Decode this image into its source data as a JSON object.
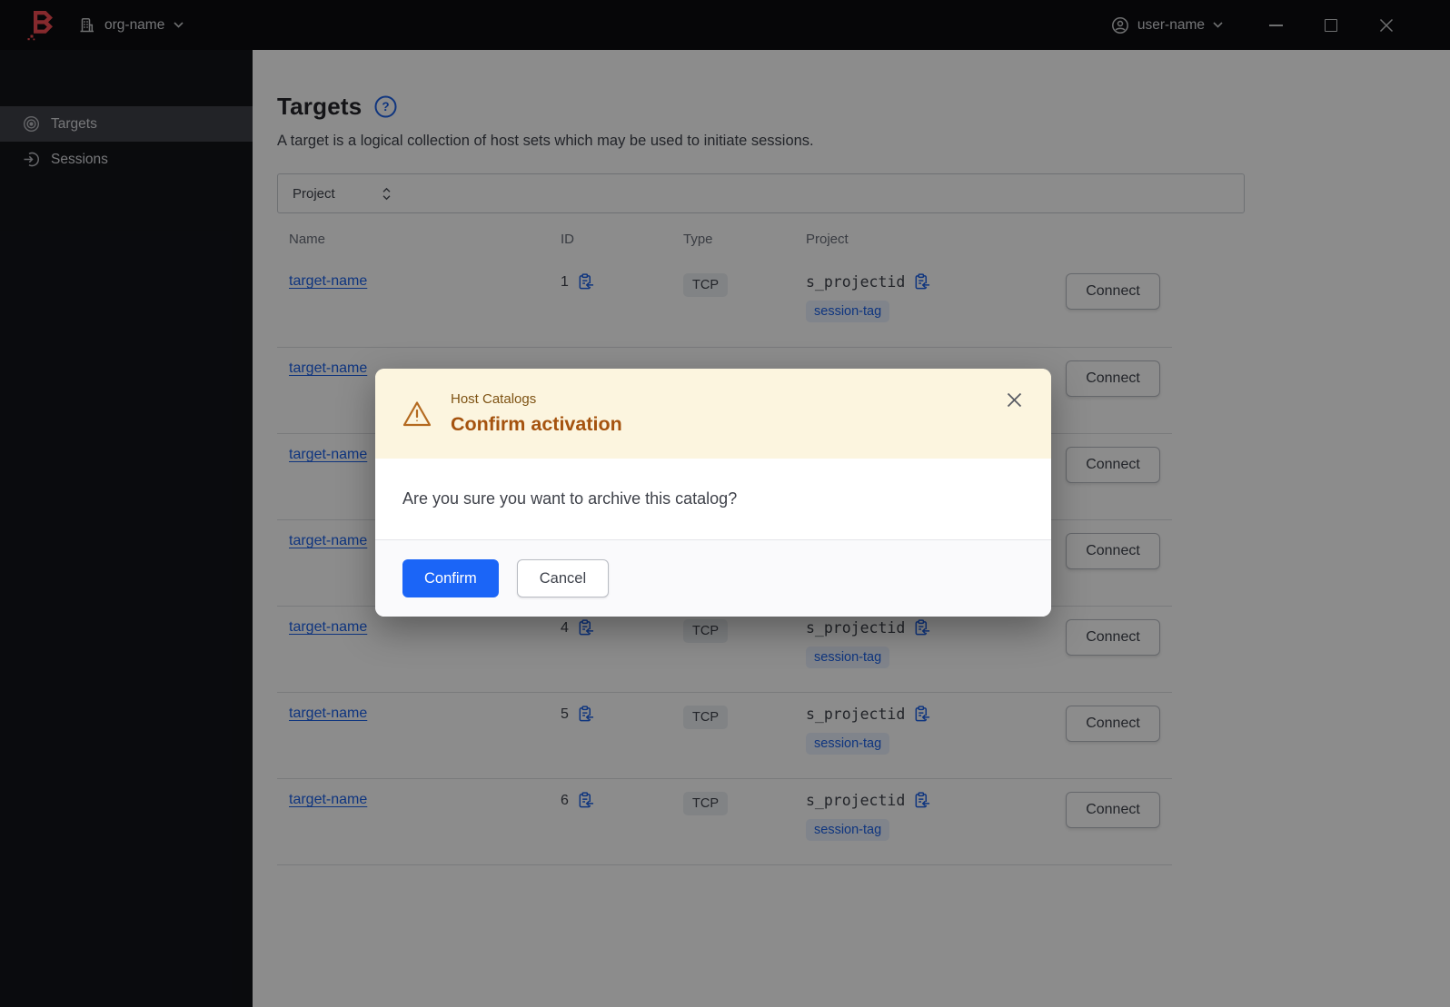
{
  "titlebar": {
    "org_name": "org-name",
    "user_name": "user-name"
  },
  "sidebar": {
    "items": [
      {
        "label": "Targets",
        "icon": "target-icon",
        "active": true
      },
      {
        "label": "Sessions",
        "icon": "session-icon",
        "active": false
      }
    ]
  },
  "page": {
    "title": "Targets",
    "description": "A target is a logical collection of host sets which may be used to initiate sessions."
  },
  "filter": {
    "selected": "Project"
  },
  "table": {
    "columns": [
      "Name",
      "ID",
      "Type",
      "Project"
    ],
    "rows": [
      {
        "name": "target-name",
        "id": "1",
        "type": "TCP",
        "project": "s_projectid",
        "tag": "session-tag",
        "connect": "Connect"
      },
      {
        "name": "target-name",
        "id": "",
        "type": "",
        "project": "",
        "tag": "",
        "connect": "Connect"
      },
      {
        "name": "target-name",
        "id": "",
        "type": "",
        "project": "",
        "tag": "",
        "connect": "Connect"
      },
      {
        "name": "target-name",
        "id": "",
        "type": "",
        "project": "",
        "tag": "",
        "connect": "Connect"
      },
      {
        "name": "target-name",
        "id": "4",
        "type": "TCP",
        "project": "s_projectid",
        "tag": "session-tag",
        "connect": "Connect"
      },
      {
        "name": "target-name",
        "id": "5",
        "type": "TCP",
        "project": "s_projectid",
        "tag": "session-tag",
        "connect": "Connect"
      },
      {
        "name": "target-name",
        "id": "6",
        "type": "TCP",
        "project": "s_projectid",
        "tag": "session-tag",
        "connect": "Connect"
      }
    ]
  },
  "modal": {
    "tagline": "Host Catalogs",
    "title": "Confirm activation",
    "message": "Are you sure you want to archive this catalog?",
    "confirm_label": "Confirm",
    "cancel_label": "Cancel"
  },
  "colors": {
    "brand_red": "#f24c53",
    "action_blue": "#1b65f7",
    "link_blue": "#1c61e7",
    "warning_surface": "#fcf5df",
    "warning_title": "#a5530f"
  }
}
